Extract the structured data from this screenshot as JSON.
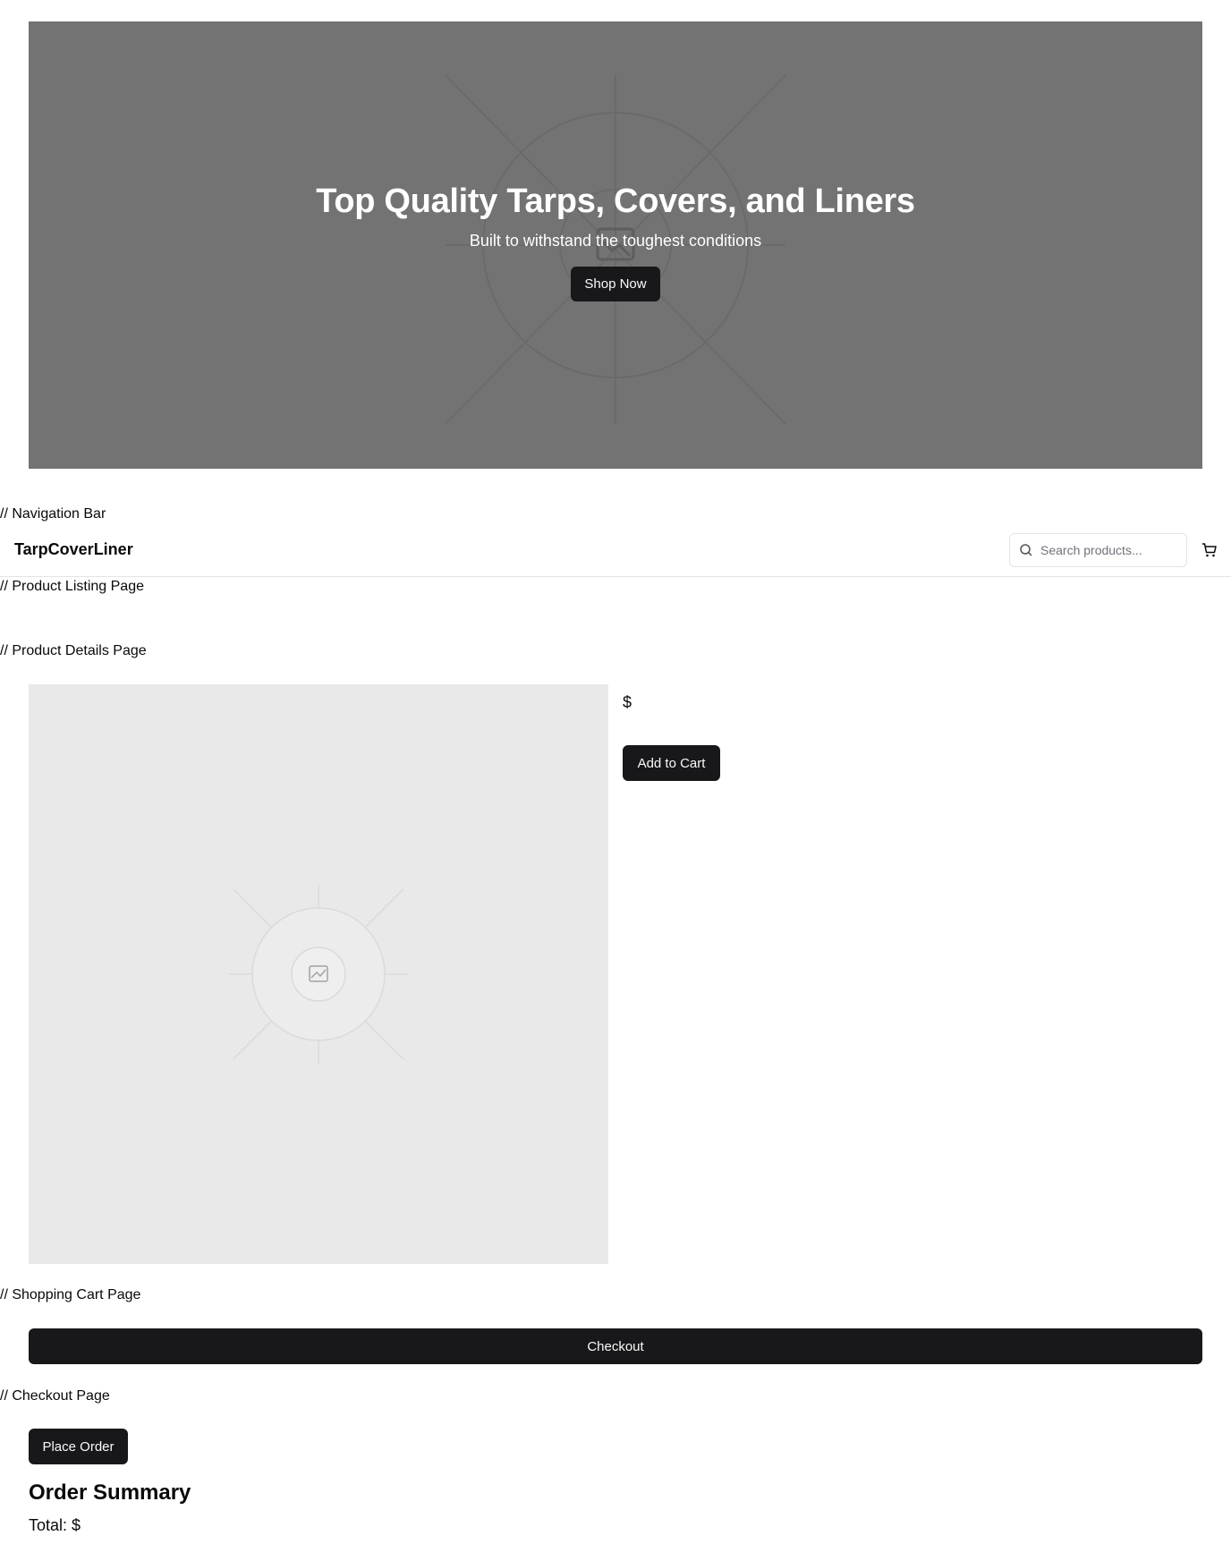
{
  "hero": {
    "title": "Top Quality Tarps, Covers, and Liners",
    "subtitle": "Built to withstand the toughest conditions",
    "cta_label": "Shop Now",
    "background_color": "#737373"
  },
  "comments": {
    "nav": "// Navigation Bar",
    "listing": "// Product Listing Page",
    "details": "// Product Details Page",
    "cart": "// Shopping Cart Page",
    "checkout": "// Checkout Page"
  },
  "nav": {
    "brand": "TarpCoverLiner",
    "search_placeholder": "Search products...",
    "search_icon": "search-icon",
    "cart_icon": "cart-icon"
  },
  "product": {
    "price": "$",
    "add_to_cart_label": "Add to Cart",
    "image_icon": "image-icon"
  },
  "cart": {
    "checkout_label": "Checkout"
  },
  "checkout": {
    "place_order_label": "Place Order",
    "summary_title": "Order Summary",
    "total": "Total: $"
  },
  "colors": {
    "primary_button": "#18181b",
    "border": "#e4e4e7",
    "image_placeholder": "#e9e9e9"
  }
}
